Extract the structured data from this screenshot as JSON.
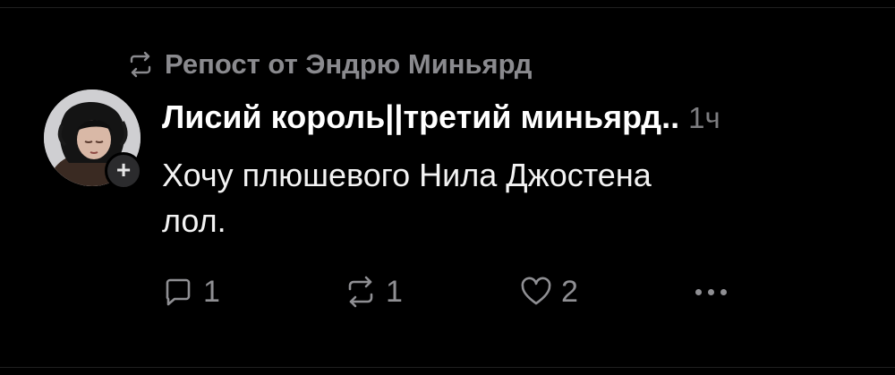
{
  "repost": {
    "label": "Репост от Эндрю Миньярд",
    "icon": "repost-icon"
  },
  "post": {
    "author": "Лисий король||третий миньярд..",
    "time": "1ч",
    "text_line1": "Хочу плюшевого Нила Джостена",
    "text_line2": "лол.",
    "avatar_icon": "user-avatar",
    "follow_symbol": "+"
  },
  "actions": {
    "reply_count": "1",
    "repost_count": "1",
    "like_count": "2",
    "reply_icon": "comment-icon",
    "repost_icon": "repost-icon",
    "like_icon": "heart-icon",
    "more_icon": "more-dots-icon"
  },
  "colors": {
    "background": "#000000",
    "primary_text": "#ffffff",
    "secondary_text": "#8a8a8e"
  }
}
